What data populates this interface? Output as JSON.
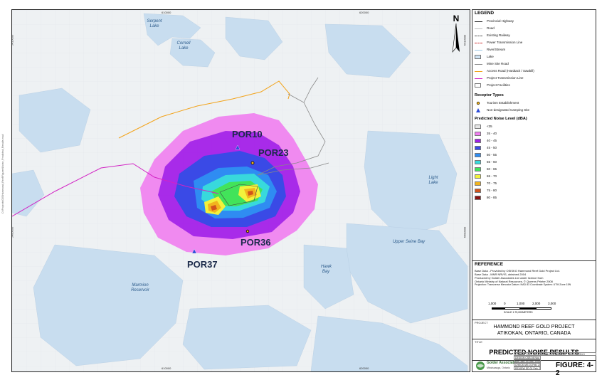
{
  "map": {
    "coords_top": [
      "610000",
      "620000"
    ],
    "coords_bottom": [
      "610000",
      "620000"
    ],
    "coords_left": [
      "5410000",
      "5400000"
    ],
    "coords_right": [
      "5410000",
      "5400000"
    ],
    "water_labels": [
      {
        "id": "serpent",
        "text": "Serpent Lake"
      },
      {
        "id": "cornell",
        "text": "Cornell Lake"
      },
      {
        "id": "light",
        "text": "Light Lake"
      },
      {
        "id": "upper-seine",
        "text": "Upper Seine Bay"
      },
      {
        "id": "hawk",
        "text": "Hawk Bay"
      },
      {
        "id": "marmion",
        "text": "Marmion Reservoir"
      }
    ],
    "receptors": [
      {
        "id": "POR10",
        "label": "POR10",
        "type": "camping"
      },
      {
        "id": "POR23",
        "label": "POR23",
        "type": "tourism"
      },
      {
        "id": "POR36",
        "label": "POR36",
        "type": "tourism"
      },
      {
        "id": "POR37",
        "label": "POR37",
        "type": "camping"
      }
    ],
    "north_letter": "N",
    "edge_strip": "O:\\Projects\\GIS\\Hammond_Reef\\Figures\\Noise_Predicted_Results.mxd"
  },
  "legend": {
    "title": "LEGEND",
    "lines": [
      {
        "label": "Provincial Highway",
        "color": "#222222",
        "style": "line"
      },
      {
        "label": "Road",
        "color": "#bbbbbb",
        "style": "line"
      },
      {
        "label": "Existing Railway",
        "color": "#555555",
        "style": "dash"
      },
      {
        "label": "Power Transmission Line",
        "color": "#cc3333",
        "style": "dash"
      },
      {
        "label": "River/Stream",
        "color": "#9cc6e4",
        "style": "line"
      },
      {
        "label": "Lake",
        "color": "#cfe3f3",
        "style": "box"
      },
      {
        "label": "Mine Site Road",
        "color": "#888888",
        "style": "line"
      },
      {
        "label": "Access Road (Hardtack / Sawbill)",
        "color": "#f2a31b",
        "style": "line"
      },
      {
        "label": "Project Transmission Line",
        "color": "#d223c4",
        "style": "line"
      },
      {
        "label": "Project Facilities",
        "color": "#ffffff",
        "style": "box"
      }
    ],
    "receptor_title": "Receptor Types",
    "receptor_types": [
      "Tourism Establishment",
      "Non-designated Camping Site"
    ],
    "noise_title": "Predicted Noise Level (dBA)",
    "noise_levels": [
      {
        "label": "<35",
        "color": "#e6e6e6"
      },
      {
        "label": "35 - 40",
        "color": "#f07ef0"
      },
      {
        "label": "40 - 45",
        "color": "#a020e8"
      },
      {
        "label": "45 - 50",
        "color": "#3a4ae6"
      },
      {
        "label": "50 - 55",
        "color": "#2f8cf2"
      },
      {
        "label": "55 - 60",
        "color": "#38d9dc"
      },
      {
        "label": "60 - 65",
        "color": "#42e35a"
      },
      {
        "label": "65 - 70",
        "color": "#f2f23c"
      },
      {
        "label": "70 - 75",
        "color": "#f2b41e"
      },
      {
        "label": "75 - 80",
        "color": "#d2541c"
      },
      {
        "label": "80 - 85",
        "color": "#8a1010"
      }
    ]
  },
  "reference": {
    "title": "REFERENCE",
    "lines": [
      "Base Data - Provided by OSISKO Hammond Reef Gold Project Ltd.",
      "Base Data - MNR NRVIS, obtained 2004",
      "Produced by Golder Associates Ltd under licence from",
      "Ontario Ministry of Natural Resources, © Queens Printer 2008",
      "Projection: Transverse Mercator   Datum: NAD 83   Coordinate System: UTM Zone 15N"
    ],
    "scale_ticks": [
      "1,000",
      "0",
      "1,000",
      "2,000",
      "3,000"
    ],
    "scale_text": "SCALE 1:75,000",
    "scale_units": "METERS"
  },
  "title_block": {
    "project_label": "PROJECT",
    "project_line1": "HAMMOND REEF GOLD PROJECT",
    "project_line2": "ATIKOKAN, ONTARIO, CANADA",
    "title_label": "TITLE",
    "title": "PREDICTED NOISE RESULTS",
    "company_name": "Golder Associates",
    "company_city": "Mississauga, Ontario",
    "cells": [
      {
        "id": "proj-no",
        "text": "PROJECT NO. 10-1118-0020"
      },
      {
        "id": "scale",
        "text": "SCALE AS SHOWN"
      },
      {
        "id": "rev",
        "text": "REVISION 0"
      },
      {
        "id": "design",
        "text": "DESIGN  CSB  04 Nov. 2009"
      },
      {
        "id": "gis",
        "text": "GIS  JAD  29 Dec. 2011"
      },
      {
        "id": "check",
        "text": "CHECK  MS  01 Feb. 2011"
      },
      {
        "id": "review",
        "text": "REVIEW  SD  01 Feb. 2011"
      }
    ],
    "figure": "FIGURE: 4-2"
  }
}
